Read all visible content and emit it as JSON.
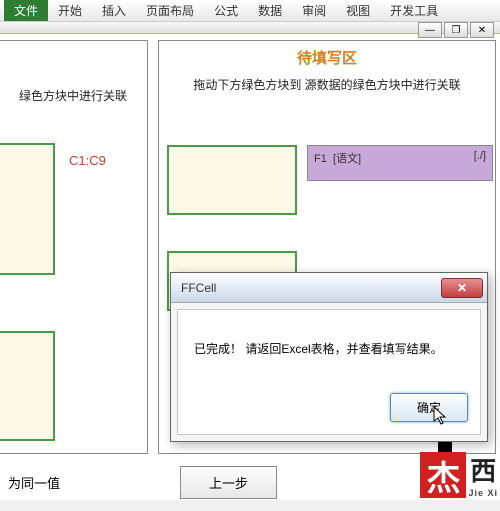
{
  "ribbon": {
    "tabs": [
      "文件",
      "开始",
      "插入",
      "页面布局",
      "公式",
      "数据",
      "审阅",
      "视图",
      "开发工具"
    ]
  },
  "leftPanel": {
    "subtitle": "绿色方块中进行关联",
    "cellRef": "C1:C9"
  },
  "rightPanel": {
    "title": "待填写区",
    "subtitle": "拖动下方绿色方块到 源数据的绿色方块中进行关联",
    "item": {
      "code": "F1",
      "subject": "[语文]",
      "mark": "[./]"
    }
  },
  "bottom": {
    "label": "为同一值",
    "prevBtn": "上一步"
  },
  "dialog": {
    "title": "FFCell",
    "message": "已完成！ 请返回Excel表格，并查看填写结果。",
    "okBtn": "确定"
  },
  "watermark": {
    "char1": "杰",
    "char2": "西",
    "pinyin": "Jie Xi"
  }
}
